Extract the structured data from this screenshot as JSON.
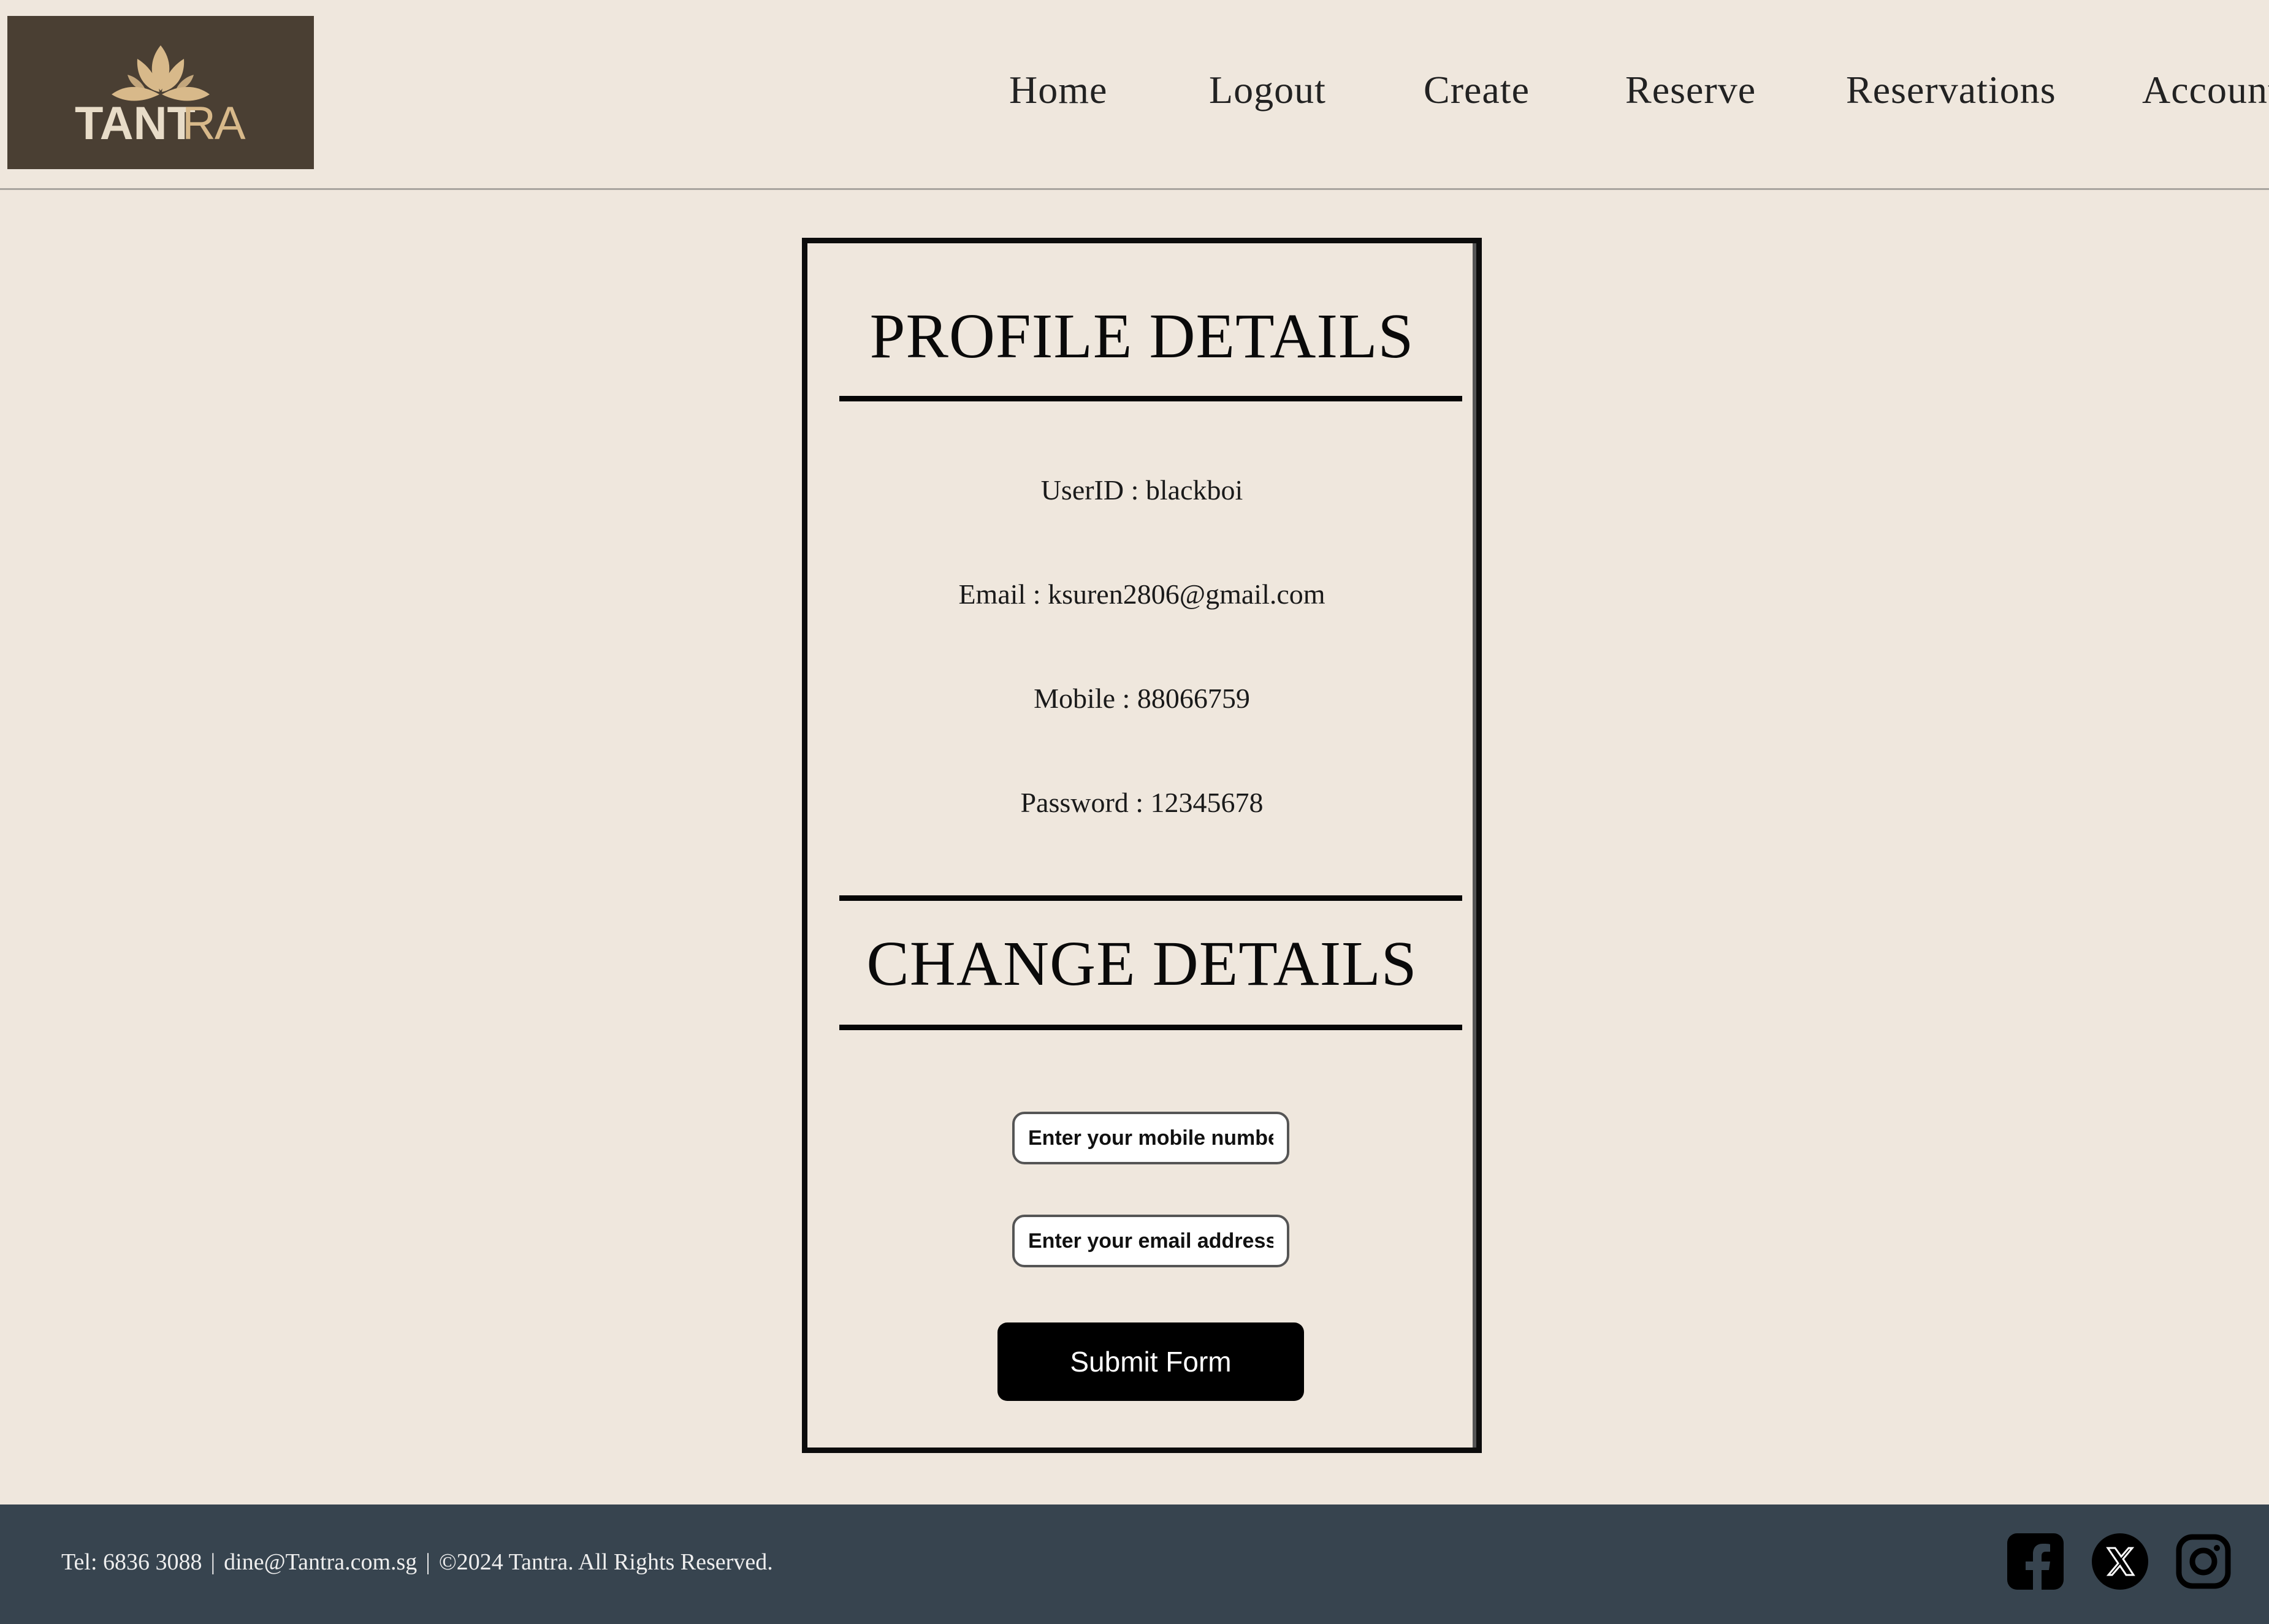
{
  "brand": {
    "logo_text": "TANTRA"
  },
  "nav": {
    "items": [
      {
        "label": "Home"
      },
      {
        "label": "Logout"
      },
      {
        "label": "Create"
      },
      {
        "label": "Reserve"
      },
      {
        "label": "Reservations"
      },
      {
        "label": "Account"
      }
    ]
  },
  "profile": {
    "title": "PROFILE DETAILS",
    "userid": "UserID : blackboi",
    "email": "Email : ksuren2806@gmail.com",
    "mobile": "Mobile : 88066759",
    "password": "Password : 12345678"
  },
  "change": {
    "title": "CHANGE DETAILS",
    "mobile_placeholder": "Enter your mobile number",
    "email_placeholder": "Enter your email address",
    "submit_label": "Submit Form"
  },
  "footer": {
    "tel": "Tel: 6836 3088",
    "email": "dine@Tantra.com.sg",
    "copyright": "©2024 Tantra. All Rights Reserved.",
    "separator": "|",
    "social": [
      "facebook-icon",
      "x-twitter-icon",
      "instagram-icon"
    ]
  },
  "colors": {
    "background": "#efe7dd",
    "logo_bg": "#4a3f33",
    "logo_gold": "#d8b98a",
    "footer_bg": "#37444f",
    "button_bg": "#000000"
  }
}
